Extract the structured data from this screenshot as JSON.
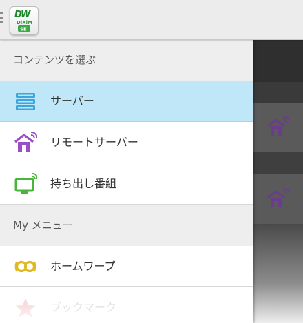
{
  "app": {
    "logo_text_top": "DiXiM",
    "logo_text_bottom": "SE",
    "logo_brand": "DiXiM",
    "accent_color": "#bfe7f7"
  },
  "drawer": {
    "sections": [
      {
        "header": "コンテンツを選ぶ",
        "items": [
          {
            "label": "サーバー",
            "icon": "server-icon",
            "icon_color": "#3ba6dc",
            "selected": true
          },
          {
            "label": "リモートサーバー",
            "icon": "remote-server-icon",
            "icon_color": "#9a4fc4",
            "selected": false
          },
          {
            "label": "持ち出し番組",
            "icon": "tv-icon",
            "icon_color": "#48b63a",
            "selected": false
          }
        ]
      },
      {
        "header": "My メニュー",
        "items": [
          {
            "label": "ホームワープ",
            "icon": "home-warp-icon",
            "icon_color": "#e0b922",
            "selected": false
          },
          {
            "label": "ブックマーク",
            "icon": "star-icon",
            "icon_color": "#e25a6a",
            "selected": false
          }
        ]
      }
    ]
  },
  "background_list": {
    "row_icon": "remote-home-icon",
    "row_icon_color": "#6b3c8c"
  }
}
